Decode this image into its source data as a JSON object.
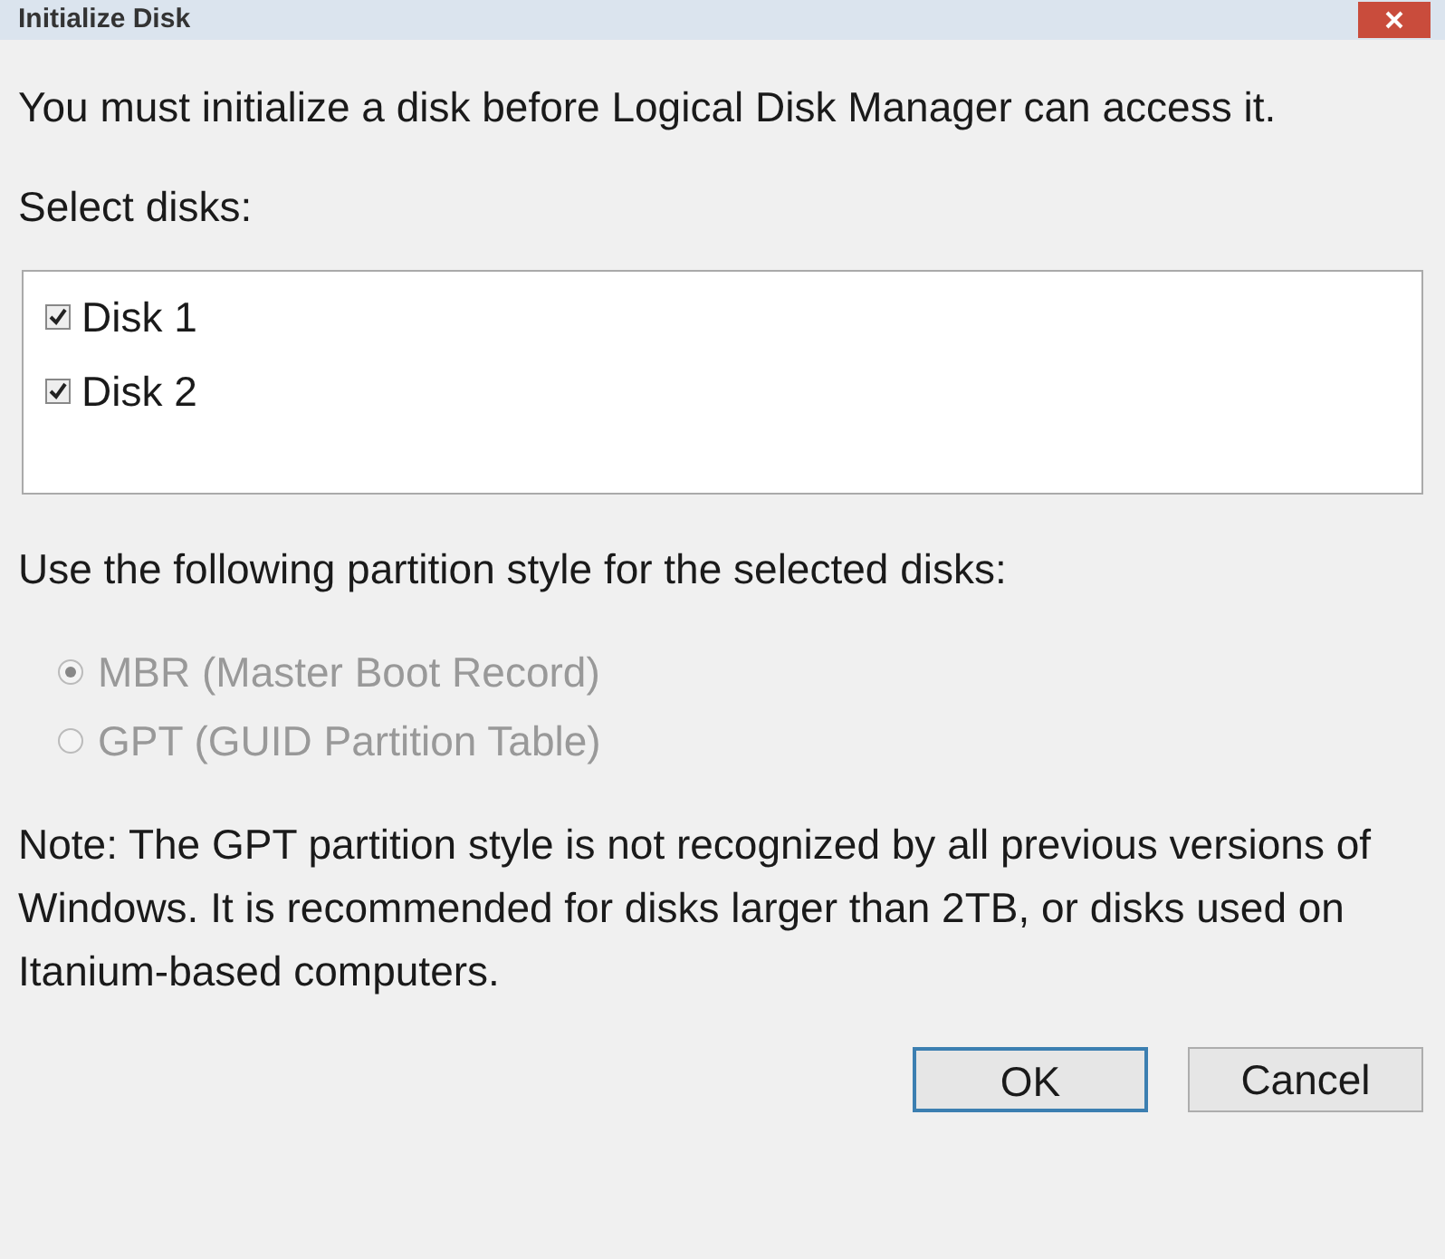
{
  "window": {
    "title": "Initialize Disk"
  },
  "intro": "You must initialize a disk before Logical Disk Manager can access it.",
  "disks_label": "Select disks:",
  "disks": [
    {
      "label": "Disk 1",
      "checked": true
    },
    {
      "label": "Disk 2",
      "checked": true
    }
  ],
  "partition_label": "Use the following partition style for the selected disks:",
  "partition_styles": [
    {
      "label": "MBR (Master Boot Record)",
      "selected": true,
      "disabled": true
    },
    {
      "label": "GPT (GUID Partition Table)",
      "selected": false,
      "disabled": true
    }
  ],
  "note": "Note: The GPT partition style is not recognized by all previous versions of Windows. It is recommended for disks larger than 2TB, or disks used on Itanium-based computers.",
  "buttons": [
    {
      "label": "OK",
      "default": true
    },
    {
      "label": "Cancel",
      "default": false
    }
  ]
}
